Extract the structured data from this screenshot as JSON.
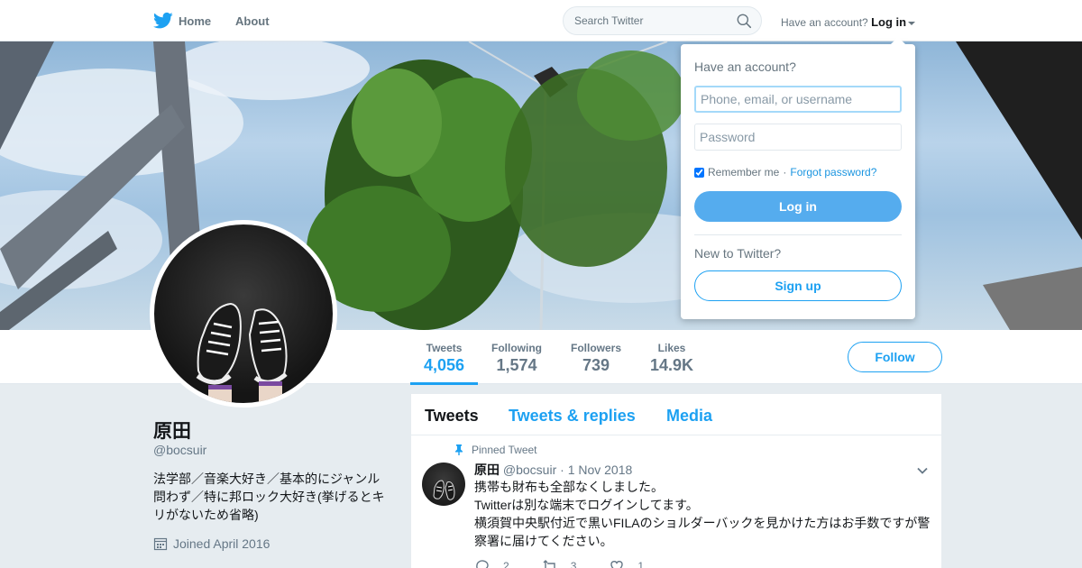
{
  "topbar": {
    "home_label": "Home",
    "about_label": "About",
    "search_placeholder": "Search Twitter",
    "account_prompt": "Have an account?",
    "login_label": "Log in"
  },
  "login_dropdown": {
    "title": "Have an account?",
    "username_placeholder": "Phone, email, or username",
    "password_placeholder": "Password",
    "remember_me": "Remember me",
    "separator": "·",
    "forgot_password": "Forgot password?",
    "login_button": "Log in",
    "new_prompt": "New to Twitter?",
    "signup_button": "Sign up"
  },
  "profile": {
    "name": "原田",
    "handle": "@bocsuir",
    "bio": "法学部／音楽大好き／基本的にジャンル問わず／特に邦ロック大好き(挙げるとキリがないため省略)",
    "joined": "Joined April 2016"
  },
  "stats": [
    {
      "label": "Tweets",
      "value": "4,056"
    },
    {
      "label": "Following",
      "value": "1,574"
    },
    {
      "label": "Followers",
      "value": "739"
    },
    {
      "label": "Likes",
      "value": "14.9K"
    }
  ],
  "follow_button": "Follow",
  "timeline": {
    "tabs": [
      "Tweets",
      "Tweets & replies",
      "Media"
    ],
    "pinned_label": "Pinned Tweet",
    "tweet": {
      "name": "原田",
      "handle": "@bocsuir",
      "separator": "·",
      "date": "1 Nov 2018",
      "lines": [
        "携帯も財布も全部なくしました。",
        "Twitterは別な端末でログインしてます。",
        "横須賀中央駅付近で黒いFILAのショルダーバックを見かけた方はお手数ですが警察署に届けてください。"
      ],
      "replies": "2",
      "retweets": "3",
      "likes": "1"
    }
  },
  "colors": {
    "accent": "#1da1f2",
    "login_button": "#55acee",
    "background": "#e6ecf0"
  }
}
